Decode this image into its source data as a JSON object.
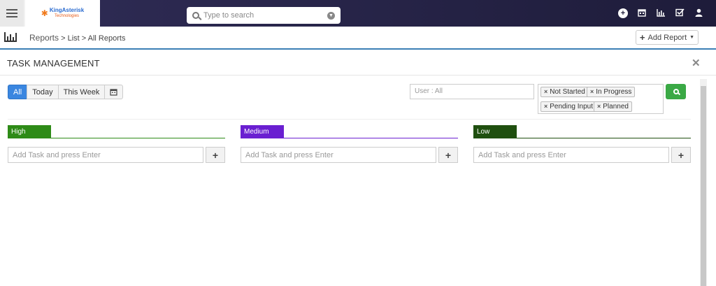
{
  "header": {
    "logo_text": "KingAsterisk",
    "logo_sub": "Technologies",
    "search_placeholder": "Type to search"
  },
  "breadcrumb": {
    "section": "Reports",
    "sep1": " > ",
    "list": "List",
    "sep2": " > ",
    "current": "All Reports"
  },
  "add_report_label": "Add Report",
  "modal": {
    "title": "TASK MANAGEMENT"
  },
  "filters": {
    "range_buttons": [
      "All",
      "Today",
      "This Week"
    ],
    "user_placeholder": "User : All",
    "status_tags": [
      "Not Started",
      "In Progress",
      "Pending Input",
      "Planned"
    ]
  },
  "columns": [
    {
      "label": "High",
      "color": "#2e8b17",
      "line_color": "#2e8b17",
      "placeholder": "Add Task and press Enter"
    },
    {
      "label": "Medium",
      "color": "#6a1fd1",
      "line_color": "#6a1fd1",
      "placeholder": "Add Task and press Enter"
    },
    {
      "label": "Low",
      "color": "#1f4f0f",
      "line_color": "#1f4f0f",
      "placeholder": "Add Task and press Enter"
    }
  ],
  "icons": {
    "menu": "hamburger-icon",
    "add": "circle-plus-icon",
    "calendar": "calendar-icon",
    "chart": "bar-chart-icon",
    "tasks": "checkbox-icon",
    "user": "user-icon"
  }
}
